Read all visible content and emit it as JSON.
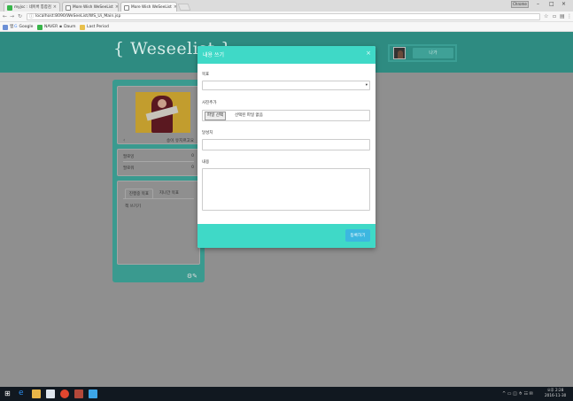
{
  "browser": {
    "tabs": [
      {
        "label": "myjsc : 네이버 통합검"
      },
      {
        "label": "More Wish WeSeeList"
      },
      {
        "label": "More Wish WeSeeList"
      }
    ],
    "profile_badge": "Chrome",
    "url": "localhost:8090/WeSeeList/WS_Ui_Main.jsp",
    "bookmarks": [
      {
        "label": "앱"
      },
      {
        "label": "Google"
      },
      {
        "label": "NAVER"
      },
      {
        "label": "Daum"
      },
      {
        "label": "Last Period"
      }
    ]
  },
  "header": {
    "logo": "{ Weseelist }",
    "user_button": "나가"
  },
  "profile_card": {
    "name": "송이 유지르고요",
    "stats": [
      {
        "label": "팔로잉",
        "value": "0"
      },
      {
        "label": "팔로워",
        "value": "0"
      }
    ],
    "tabs": [
      {
        "label": "진행중 목표"
      },
      {
        "label": "지나간 목표"
      }
    ],
    "list_item": "책 쓰기기",
    "colors": {
      "card": "#3a9a8f"
    }
  },
  "modal": {
    "title": "내용 쓰기",
    "close_symbol": "×",
    "fields": {
      "category_label": "목표",
      "category_value": "",
      "photo_label": "사진추가",
      "file_button": "파일 선택",
      "file_status": "선택된 파일 없음",
      "achieved_label": "달성치",
      "achieved_value": "",
      "content_label": "내용",
      "content_value": ""
    },
    "submit_label": "등록하기",
    "colors": {
      "header": "#3fd9c7",
      "submit": "#3cb7e0"
    }
  },
  "taskbar": {
    "time": "오후 2:28",
    "date": "2016-11-30"
  }
}
